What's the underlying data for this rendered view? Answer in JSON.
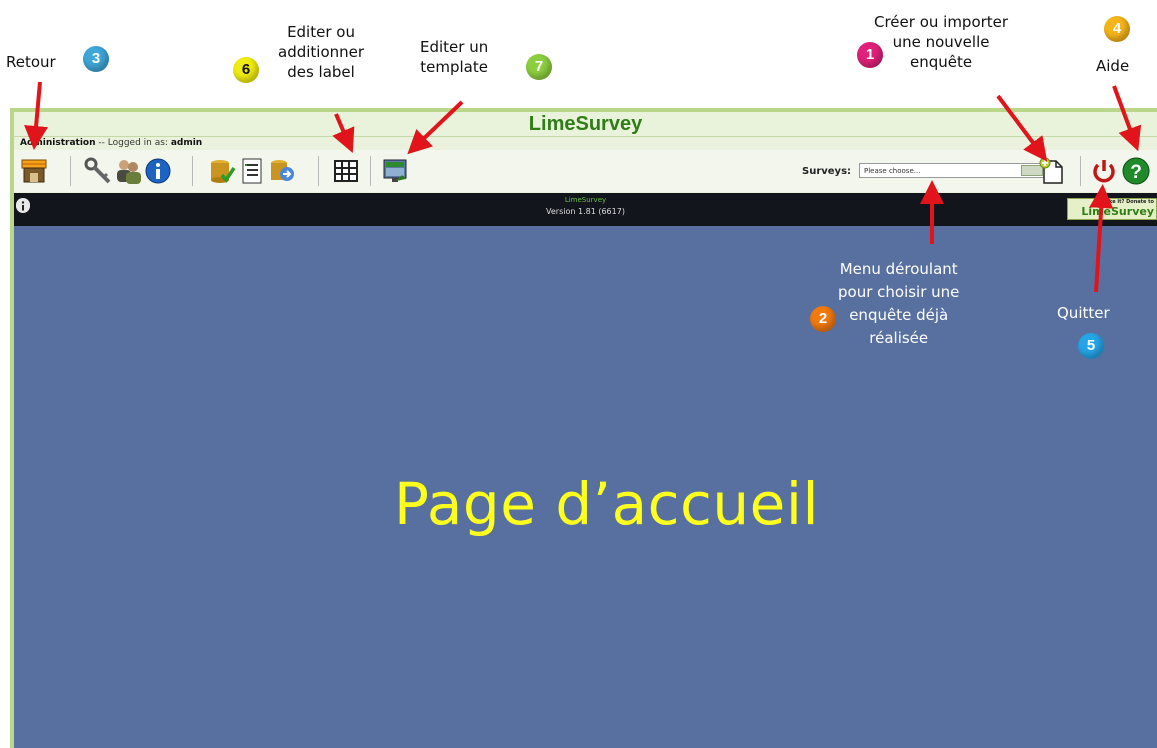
{
  "app": {
    "title": "LimeSurvey",
    "admin_prefix": "Administration",
    "logged_in_text": "-- Logged in as:",
    "user": "admin",
    "version_name": "LimeSurvey",
    "version_text": "Version 1.81 (6617)",
    "donate_text": "Like it? Donate to",
    "donate_logo": "LimeSurvey"
  },
  "toolbar": {
    "icons": [
      "home-icon",
      "key-icon",
      "users-icon",
      "info-icon",
      "database-check-icon",
      "list-icon",
      "export-icon",
      "label-grid-icon",
      "template-icon",
      "new-survey-icon",
      "power-icon",
      "help-icon"
    ],
    "surveys_label": "Surveys:",
    "surveys_select_value": "Please choose..."
  },
  "main": {
    "page_title": "Page d’accueil"
  },
  "annotations": {
    "retour": "Retour",
    "editer_label_1": "Editer ou",
    "editer_label_2": "additionner",
    "editer_label_3": "des label",
    "editer_template_1": "Editer un",
    "editer_template_2": "template",
    "creer_1": "Créer ou importer",
    "creer_2": "une nouvelle",
    "creer_3": "enquête",
    "aide": "Aide",
    "menu_1": "Menu déroulant",
    "menu_2": "pour choisir une",
    "menu_3": "enquête déjà",
    "menu_4": "réalisée",
    "quitter": "Quitter",
    "n1": "1",
    "n2": "2",
    "n3": "3",
    "n4": "4",
    "n5": "5",
    "n6": "6",
    "n7": "7"
  },
  "colors": {
    "brand_green": "#2f7d15",
    "page_bg": "#5870a0",
    "title_yellow": "#ffff1e",
    "arrow_red": "#e0141a"
  }
}
